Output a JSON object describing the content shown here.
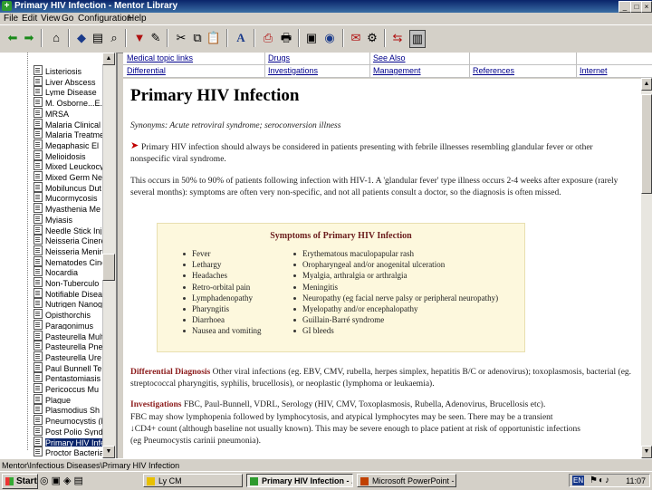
{
  "window": {
    "title": "Primary HIV Infection - Mentor Library",
    "buttons": [
      "_",
      "□",
      "×"
    ]
  },
  "menu": [
    "File",
    "Edit",
    "View",
    "Go",
    "Configuration",
    "Help"
  ],
  "nav": {
    "row1": [
      "Medical topic links",
      "Drugs",
      "See Also"
    ],
    "row2": [
      "Differential",
      "Investigations",
      "Management",
      "References",
      "Internet"
    ]
  },
  "tree": {
    "items": [
      "Listeriosis",
      "Liver Abscess",
      "Lyme Disease",
      "M. Osborne...E.M",
      "MRSA",
      "Malaria Clinical",
      "Malaria Treatme",
      "Megaphasic El",
      "Melioidosis",
      "Mixed Leuckocyt",
      "Mixed Germ Neg",
      "Mobiluncus Dut",
      "Mucormycosis",
      "Myasthenia Me",
      "Myiasis",
      "Needle Stick Inj",
      "Neisseria Cinere",
      "Neisseria Menin",
      "Nematodes Cino",
      "Nocardia",
      "Non-Tuberculo",
      "Notifiable Disea",
      "Nutrigen Nanog",
      "Opisthorchis",
      "Paragonimus",
      "Pasteurella Mult",
      "Pasteurella Pnei",
      "Pasteurella Ure",
      "Paul Bunnell Te",
      "Pentastomiasis",
      "Pericoccus Mu",
      "Plague",
      "Plasmodius Sh",
      "Pneumocystis (N",
      "Post Polio Syndr",
      "Primary HIV Infe",
      "Proctor Bacteria"
    ],
    "selected_index": 35
  },
  "content": {
    "title": "Primary HIV Infection",
    "synonyms": "Synonyms: Acute retroviral syndrome; seroconversion illness",
    "para1": "Primary HIV infection should always be considered in patients presenting with febrile illnesses resembling glandular fever or other nonspecific viral syndrome.",
    "para2": "This occurs in 50% to 90% of patients following infection with HIV-1. A 'glandular fever' type illness occurs 2-4 weeks after exposure (rarely several months): symptoms are often very non-specific, and not all patients consult a doctor, so the diagnosis is often missed.",
    "box": {
      "title": "Symptoms of Primary HIV Infection",
      "left": [
        "Fever",
        "Lethargy",
        "Headaches",
        "Retro-orbital pain",
        "Lymphadenopathy",
        "Pharyngitis",
        "Diarrhoea",
        "Nausea and vomiting"
      ],
      "right": [
        "Erythematous maculopapular rash",
        "Oropharyngeal and/or anogenital ulceration",
        "Myalgia, arthralgia or arthralgia",
        "Meningitis",
        "Neuropathy (eg facial nerve palsy or peripheral neuropathy)",
        "Myelopathy and/or encephalopathy",
        "Guillain-Barré syndrome",
        "GI bleeds"
      ]
    },
    "diff_label": "Differential Diagnosis",
    "diff_text": "Other viral infections (eg. EBV, CMV, rubella, herpes simplex, hepatitis B/C or adenovirus); toxoplasmosis, bacterial (eg. streptococcal pharyngitis, syphilis, brucellosis), or neoplastic (lymphoma or leukaemia).",
    "inv_label": "Investigations",
    "inv_text": "FBC, Paul-Bunnell, VDRL, Serology (HIV, CMV, Toxoplasmosis, Rubella, Adenovirus, Brucellosis etc).",
    "inv_line2": "FBC may show lymphopenia followed by lymphocytosis, and atypical lymphocytes may be seen. There may be a transient",
    "inv_line3": "↓CD4+ count (although baseline not usually known). This may be severe enough to place patient at risk of opportunistic infections",
    "inv_line4": "(eg Pneumocystis carinii pneumonia)."
  },
  "status": "Mentor\\Infectious Diseases\\Primary HIV Infection",
  "taskbar": {
    "start": "Start",
    "tasks": [
      "Ly CM",
      "Primary HIV Infection - ...",
      "Microsoft PowerPoint - [N..."
    ],
    "lang": "EN",
    "clock": "11:07"
  }
}
